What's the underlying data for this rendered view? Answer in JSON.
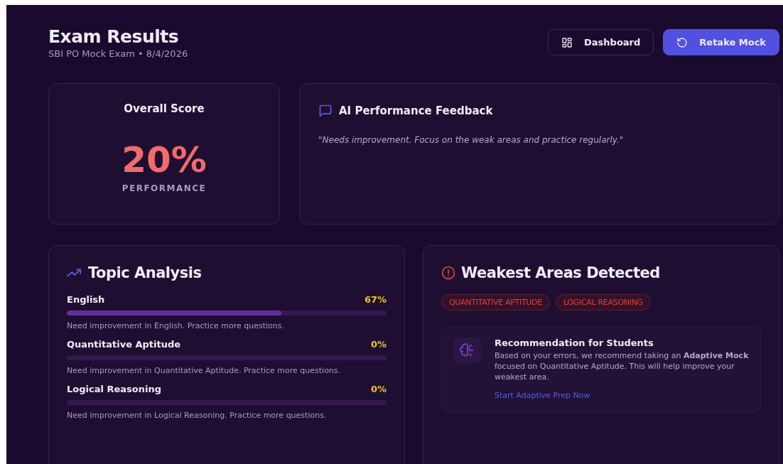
{
  "header": {
    "title": "Exam Results",
    "subtitle": "SBI PO Mock Exam • 8/4/2026"
  },
  "buttons": [
    {
      "kind": "outline",
      "label": "Dashboard"
    },
    {
      "kind": "primary",
      "label": "Retake Mock"
    }
  ],
  "score_card": {
    "title": "Overall Score",
    "score": "20%",
    "caption": "PERFORMANCE"
  },
  "feedback_card": {
    "title": "AI Performance Feedback",
    "text": "\"Needs improvement. Focus on the weak areas and practice regularly.\""
  },
  "topic_analysis": {
    "title": "Topic Analysis",
    "topics": [
      {
        "name": "English",
        "percent": "67%",
        "level": 0.67,
        "note": "Need improvement in English. Practice more questions."
      },
      {
        "name": "Quantitative Aptitude",
        "percent": "0%",
        "note": "Need improvement in Quantitative Aptitude. Practice more questions."
      },
      {
        "name": "Logical Reasoning",
        "percent": "0%",
        "note": "Need improvement in Logical Reasoning. Practice more questions."
      }
    ]
  },
  "weakest_areas": {
    "title": "Weakest Areas Detected",
    "tags": [
      "QUANTITATIVE APTITUDE",
      "LOGICAL REASONING"
    ],
    "recommendation": {
      "title": "Recommendation for Students",
      "text": "Based on your errors, we recommend taking an **Adaptive Mock** focused on Quantitative Aptitude. This will help improve your weakest area.",
      "link": "Start Adaptive Prep Now"
    }
  }
}
